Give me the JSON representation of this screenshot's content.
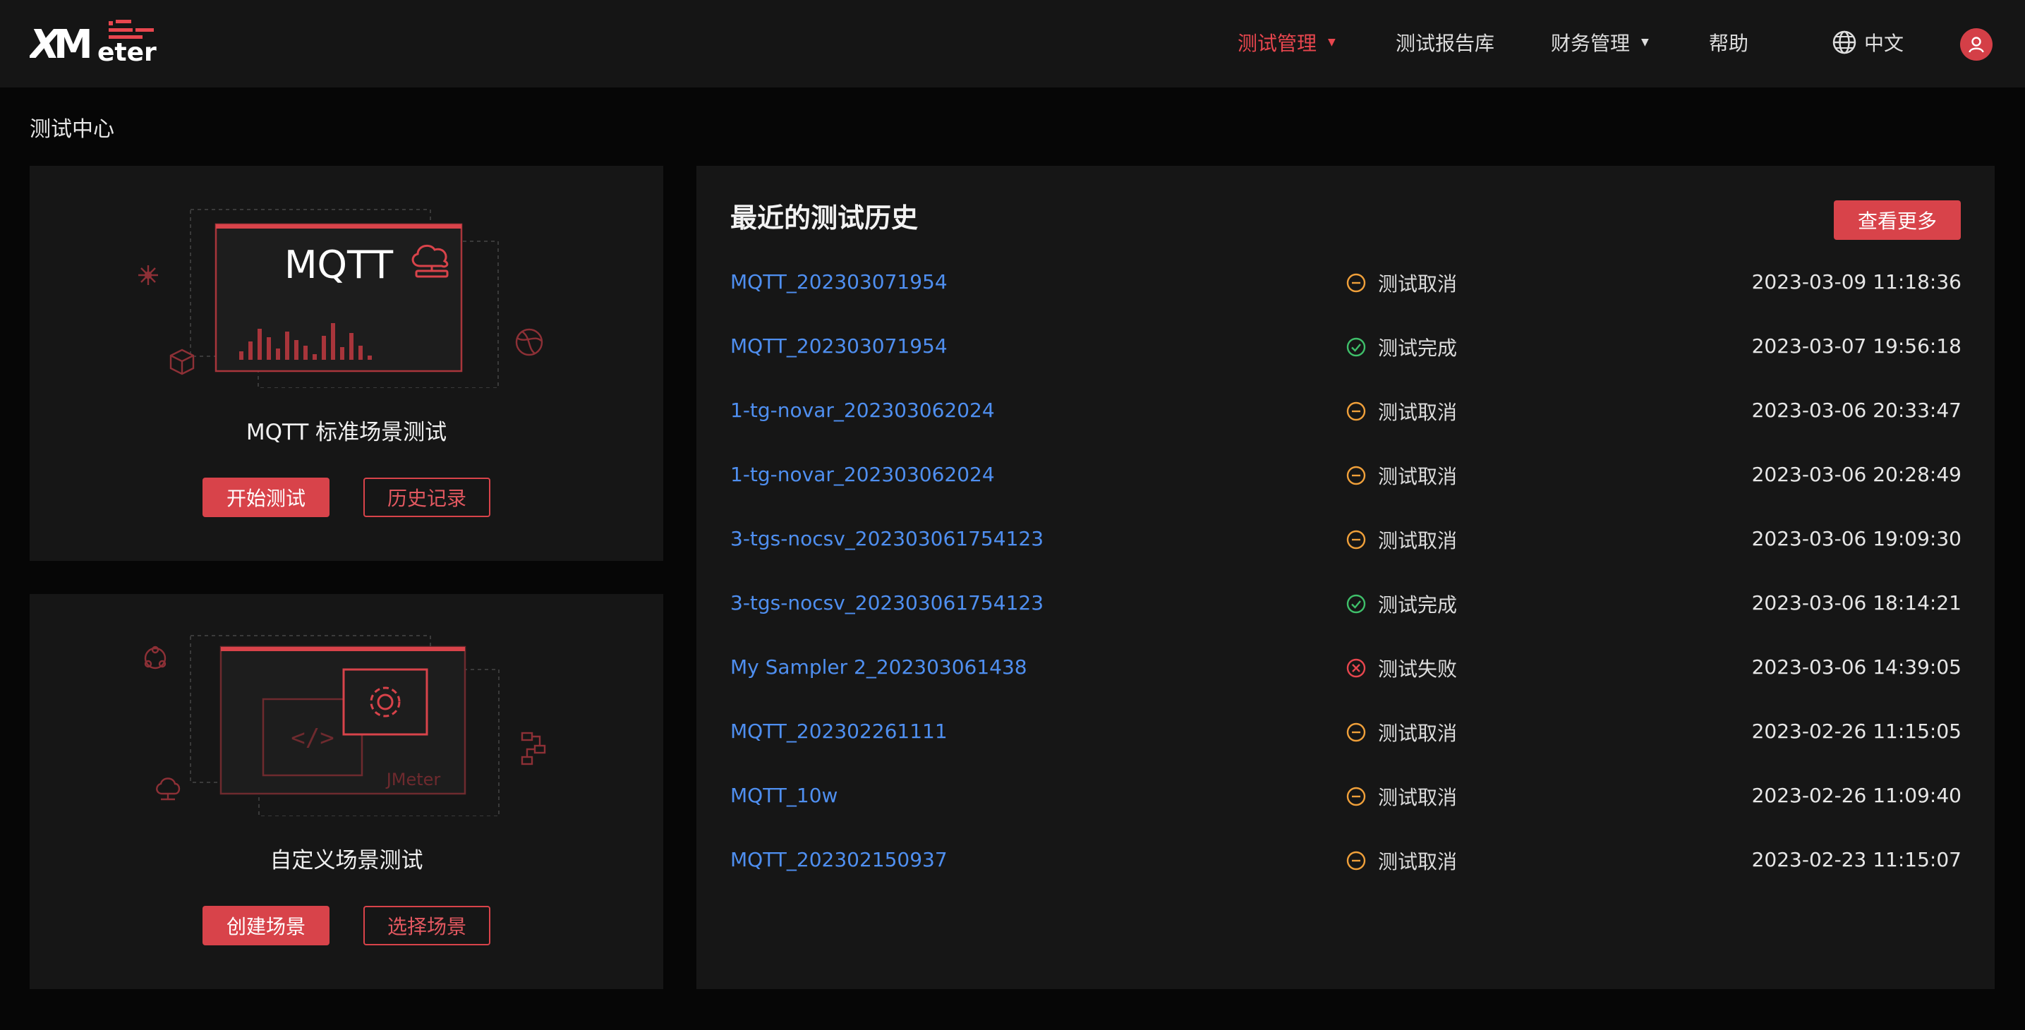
{
  "header": {
    "logo_text": "XMeter",
    "nav": [
      {
        "label": "测试管理",
        "active": true,
        "dropdown": true
      },
      {
        "label": "测试报告库",
        "active": false,
        "dropdown": false
      },
      {
        "label": "财务管理",
        "active": false,
        "dropdown": true
      },
      {
        "label": "帮助",
        "active": false,
        "dropdown": false
      }
    ],
    "language": "中文",
    "caret": "▼"
  },
  "page_title": "测试中心",
  "cards": {
    "mqtt": {
      "illustration_text": "MQTT",
      "title": "MQTT 标准场景测试",
      "primary_button": "开始测试",
      "secondary_button": "历史记录"
    },
    "custom": {
      "illustration_text": "JMeter",
      "title": "自定义场景测试",
      "primary_button": "创建场景",
      "secondary_button": "选择场景"
    }
  },
  "history": {
    "title": "最近的测试历史",
    "more_button": "查看更多",
    "rows": [
      {
        "name": "MQTT_202303071954",
        "status": "测试取消",
        "status_type": "cancel",
        "time": "2023-03-09 11:18:36"
      },
      {
        "name": "MQTT_202303071954",
        "status": "测试完成",
        "status_type": "done",
        "time": "2023-03-07 19:56:18"
      },
      {
        "name": "1-tg-novar_202303062024",
        "status": "测试取消",
        "status_type": "cancel",
        "time": "2023-03-06 20:33:47"
      },
      {
        "name": "1-tg-novar_202303062024",
        "status": "测试取消",
        "status_type": "cancel",
        "time": "2023-03-06 20:28:49"
      },
      {
        "name": "3-tgs-nocsv_202303061754123",
        "status": "测试取消",
        "status_type": "cancel",
        "time": "2023-03-06 19:09:30"
      },
      {
        "name": "3-tgs-nocsv_202303061754123",
        "status": "测试完成",
        "status_type": "done",
        "time": "2023-03-06 18:14:21"
      },
      {
        "name": "My Sampler 2_202303061438",
        "status": "测试失败",
        "status_type": "fail",
        "time": "2023-03-06 14:39:05"
      },
      {
        "name": "MQTT_202302261111",
        "status": "测试取消",
        "status_type": "cancel",
        "time": "2023-02-26 11:15:05"
      },
      {
        "name": "MQTT_10w",
        "status": "测试取消",
        "status_type": "cancel",
        "time": "2023-02-26 11:09:40"
      },
      {
        "name": "MQTT_202302150937",
        "status": "测试取消",
        "status_type": "cancel",
        "time": "2023-02-23 11:15:07"
      }
    ]
  },
  "colors": {
    "accent": "#d8434a",
    "link": "#4f8ff0",
    "status_cancel": "#f0a03a",
    "status_done": "#3fbf6a",
    "status_fail": "#e8464e"
  },
  "icons": {
    "language": "globe-icon",
    "avatar": "user-icon",
    "cancel": "minus-circle-icon",
    "done": "check-circle-icon",
    "fail": "x-circle-icon"
  }
}
